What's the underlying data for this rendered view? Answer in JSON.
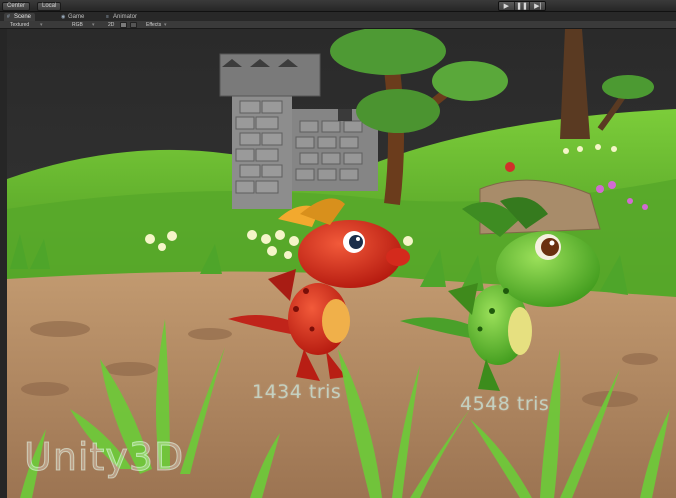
{
  "toolbar": {
    "pivot_label": "Center",
    "space_label": "Local",
    "play_icon": "play-icon",
    "pause_icon": "pause-icon",
    "step_icon": "step-icon"
  },
  "tabs": [
    {
      "label": "Scene",
      "icon": "scene-icon",
      "active": true
    },
    {
      "label": "Game",
      "icon": "game-icon",
      "active": false
    },
    {
      "label": "Animator",
      "icon": "animator-icon",
      "active": false
    }
  ],
  "scene_controls": {
    "draw_mode": "Textured",
    "render_mode": "RGB",
    "mode_2d": "2D",
    "effects": "Effects"
  },
  "overlay": {
    "red_dragon_tris": "1434 tris",
    "green_dragon_tris": "4548 tris",
    "watermark": "Unity3D"
  },
  "colors": {
    "sky": "#2b2b2b",
    "grass": "#5fae2c",
    "path": "#b38a63",
    "red_dragon": "#d42a1c",
    "green_dragon": "#5cbf2a"
  }
}
